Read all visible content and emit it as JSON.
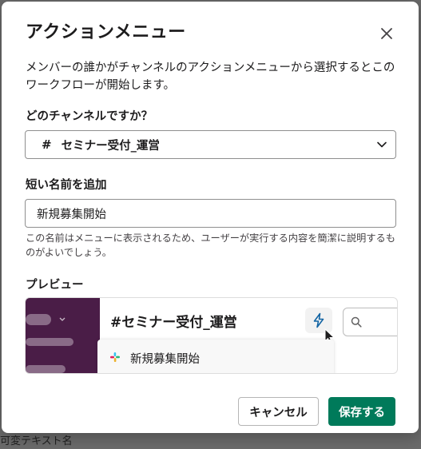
{
  "backdrop": {
    "text": "可変テキスト名"
  },
  "modal": {
    "title": "アクションメニュー",
    "description": "メンバーの誰かがチャンネルのアクションメニューから選択するとこのワークフローが開始します。"
  },
  "channel_field": {
    "label": "どのチャンネルですか？",
    "hash": "#",
    "value": "セミナー受付_運営"
  },
  "name_field": {
    "label": "短い名前を追加",
    "value": "新規募集開始",
    "hint": "この名前はメニューに表示されるため、ユーザーが実行する内容を簡潔に説明するものがよいでしょう。"
  },
  "preview": {
    "label": "プレビュー",
    "channel": "#セミナー受付_運営",
    "workflow_label": "新規募集開始"
  },
  "buttons": {
    "cancel": "キャンセル",
    "save": "保存する"
  },
  "colors": {
    "accent": "#007a5a",
    "sidebar": "#4a1d47",
    "bolt": "#1264a3"
  },
  "icons": [
    "close-icon",
    "chevron-down-icon",
    "lightning-bolt-icon",
    "search-icon",
    "cursor-icon",
    "slack-logo-icon"
  ]
}
